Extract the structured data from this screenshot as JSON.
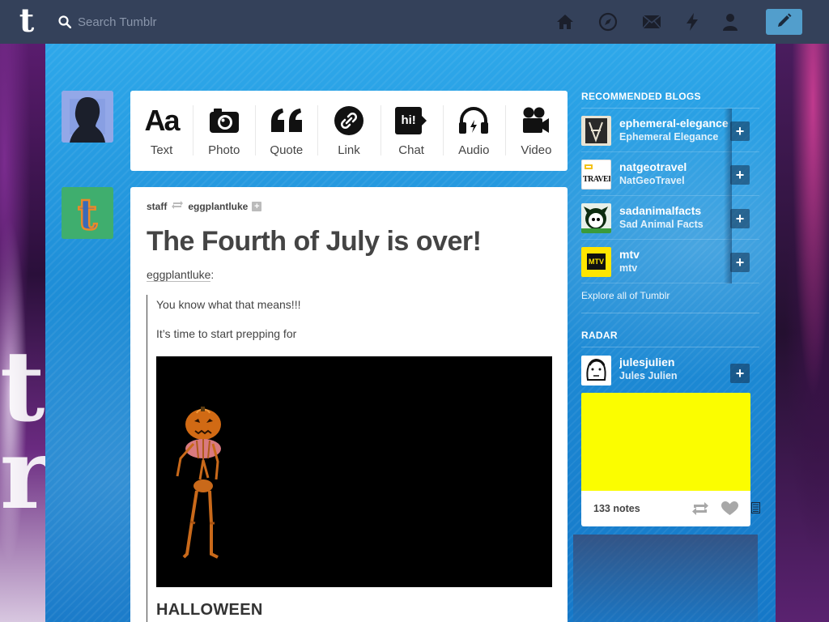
{
  "nav": {
    "search_placeholder": "Search Tumblr",
    "logo": "t"
  },
  "post_types": [
    {
      "label": "Text",
      "icon": "text-icon"
    },
    {
      "label": "Photo",
      "icon": "camera-icon"
    },
    {
      "label": "Quote",
      "icon": "quote-icon"
    },
    {
      "label": "Link",
      "icon": "link-icon"
    },
    {
      "label": "Chat",
      "icon": "chat-icon"
    },
    {
      "label": "Audio",
      "icon": "headphones-icon"
    },
    {
      "label": "Video",
      "icon": "video-camera-icon"
    }
  ],
  "post_type_glyphs": {
    "text": "Aa",
    "quote": "“",
    "chat": "hi!"
  },
  "post": {
    "author": "staff",
    "reblogged_from": "eggplantluke",
    "title": "The Fourth of July is over!",
    "source": "eggplantluke",
    "source_suffix": ":",
    "lines": [
      "You know what that means!!!",
      "It’s time to start prepping for"
    ],
    "heading": "HALLOWEEN"
  },
  "sidebar": {
    "recommended_title": "RECOMMENDED BLOGS",
    "blogs": [
      {
        "name": "ephemeral-elegance",
        "title": "Ephemeral Elegance"
      },
      {
        "name": "natgeotravel",
        "title": "NatGeoTravel"
      },
      {
        "name": "sadanimalfacts",
        "title": "Sad Animal Facts"
      },
      {
        "name": "mtv",
        "title": "mtv"
      }
    ],
    "natgeo_thumb_text": "TRAVEL",
    "mtv_thumb_text": "MTV",
    "follow_label": "+",
    "explore": "Explore all of Tumblr",
    "radar_title": "RADAR",
    "radar": {
      "name": "julesjulien",
      "title": "Jules Julien",
      "notes": "133 notes"
    }
  },
  "colors": {
    "topbar": "#34415a",
    "compose": "#529ecc",
    "radar_image": "#fbfd00"
  }
}
